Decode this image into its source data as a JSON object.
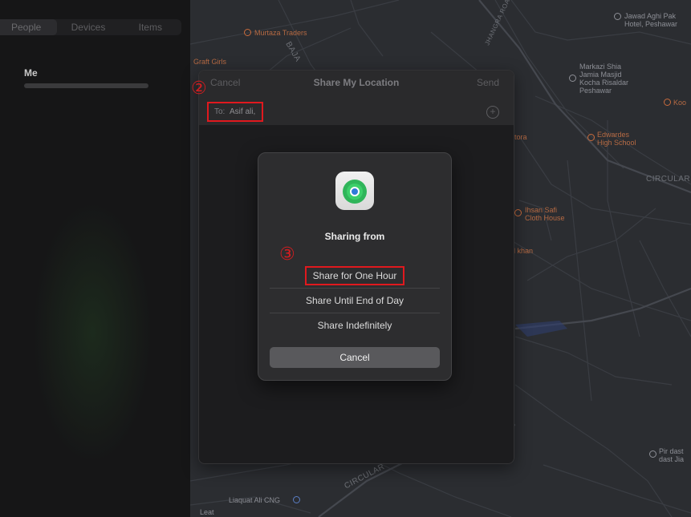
{
  "sidebar": {
    "tabs": [
      "People",
      "Devices",
      "Items"
    ],
    "me_label": "Me"
  },
  "map": {
    "labels": {
      "murtaza": "Murtaza Traders",
      "jawad_1": "Jawad Aghi Pak",
      "jawad_2": "Hotel, Peshawar",
      "graft": "Graft Girls",
      "road_baja": "BAJA",
      "road_jhangra": "JHANGRA ROAD",
      "markazi_1": "Markazi Shia",
      "markazi_2": "Jamia Masjid",
      "markazi_3": "Kocha Risaldar",
      "markazi_4": "Peshawar",
      "koo": "Koo",
      "edwardes_1": "Edwardes",
      "edwardes_2": "High School",
      "circular_right": "CIRCULAR",
      "tora": "tora",
      "ihsan_1": "Ihsan Safi",
      "ihsan_2": "Cloth House",
      "ikhan": "l khan",
      "circular_bottom": "CIRCULAR",
      "liaquat": "Liaquat Ali CNG",
      "pir_1": "Pir dast",
      "pir_2": "dast Jia",
      "leat": "Leat"
    }
  },
  "share_window": {
    "cancel": "Cancel",
    "title": "Share My Location",
    "send": "Send",
    "to_label": "To:",
    "to_value": "Asif ali,",
    "add_icon": "+"
  },
  "steps": {
    "two": "②",
    "three": "③"
  },
  "dialog": {
    "title": "Sharing from",
    "options": [
      "Share for One Hour",
      "Share Until End of Day",
      "Share Indefinitely"
    ],
    "cancel": "Cancel"
  },
  "colors": {
    "highlight": "#e0191e",
    "dialog_bg": "#2d2d2f",
    "map_bg": "#2b2d31",
    "findmy_green": "#34c759"
  }
}
